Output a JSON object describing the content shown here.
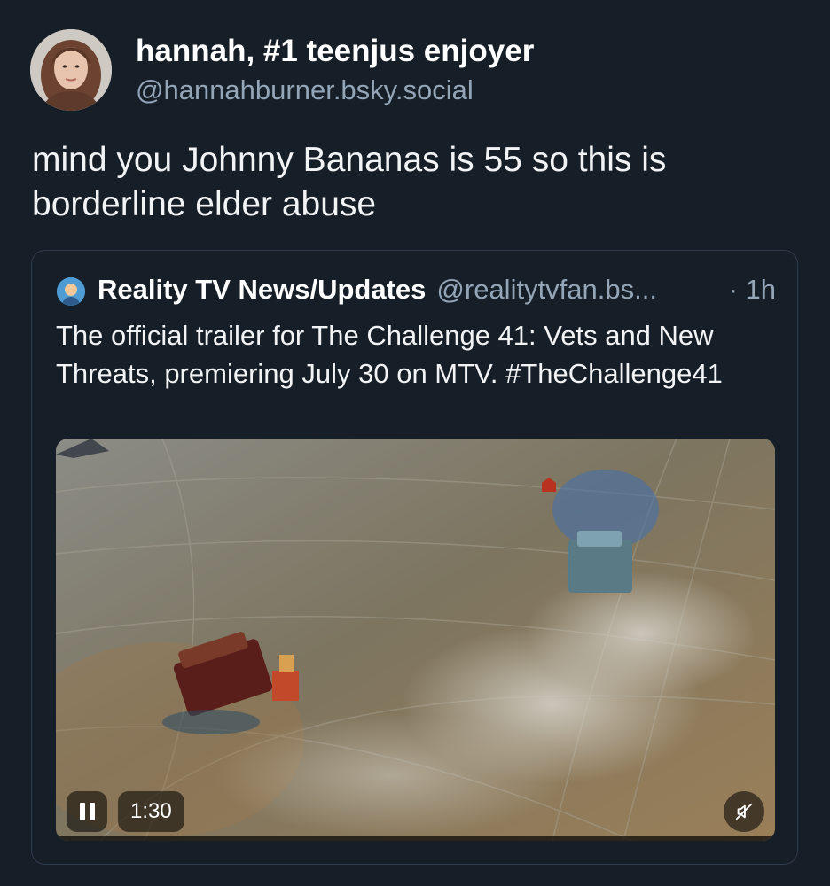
{
  "author": {
    "display_name": "hannah, #1 teenjus enjoyer",
    "handle": "@hannahburner.bsky.social",
    "avatar_icon": "avatar-photo"
  },
  "post": {
    "text": "mind you Johnny Bananas is 55 so this is borderline elder abuse"
  },
  "quoted_post": {
    "author_name": "Reality TV News/Updates",
    "author_handle": "@realitytvfan.bs...",
    "time": "· 1h",
    "avatar_icon": "avatar-icon",
    "text": "The official trailer for The Challenge 41: Vets and New Threats, premiering July 30 on MTV. #TheChallenge41",
    "video": {
      "duration": "1:30",
      "play_state_icon": "pause-icon",
      "mute_icon": "muted-speaker-icon",
      "progress": 0.0
    }
  }
}
